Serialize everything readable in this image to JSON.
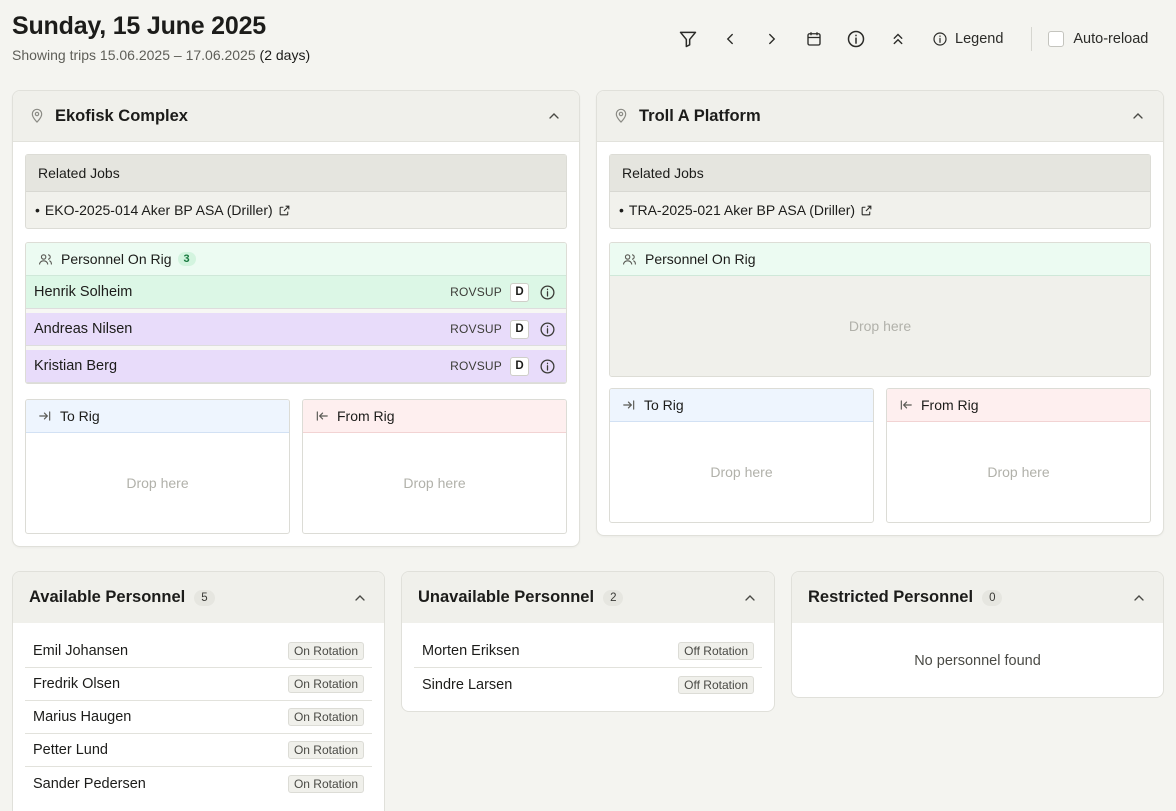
{
  "header": {
    "title": "Sunday, 15 June 2025",
    "subtitle_prefix": "Showing trips 15.06.2025 – 17.06.2025",
    "subtitle_days": "(2 days)"
  },
  "toolbar": {
    "legend_label": "Legend",
    "auto_reload_label": "Auto-reload",
    "auto_reload_checked": false
  },
  "rigs": [
    {
      "name": "Ekofisk Complex",
      "related_jobs_label": "Related Jobs",
      "jobs": [
        "EKO-2025-014 Aker BP ASA (Driller)"
      ],
      "personnel_label": "Personnel On Rig",
      "personnel_count": "3",
      "personnel": [
        {
          "name": "Henrik Solheim",
          "role": "ROVSUP",
          "badge": "D",
          "color": "#dcf7e6"
        },
        {
          "name": "Andreas Nilsen",
          "role": "ROVSUP",
          "badge": "D",
          "color": "#e8dcfa"
        },
        {
          "name": "Kristian Berg",
          "role": "ROVSUP",
          "badge": "D",
          "color": "#e8dcfa"
        }
      ],
      "to_rig_label": "To Rig",
      "from_rig_label": "From Rig",
      "to_rig_drop": "Drop here",
      "from_rig_drop": "Drop here"
    },
    {
      "name": "Troll A Platform",
      "related_jobs_label": "Related Jobs",
      "jobs": [
        "TRA-2025-021 Aker BP ASA (Driller)"
      ],
      "personnel_label": "Personnel On Rig",
      "personnel_drop": "Drop here",
      "to_rig_label": "To Rig",
      "from_rig_label": "From Rig",
      "to_rig_drop": "Drop here",
      "from_rig_drop": "Drop here"
    }
  ],
  "available": {
    "title": "Available Personnel",
    "count": "5",
    "items": [
      {
        "name": "Emil Johansen",
        "status": "On Rotation"
      },
      {
        "name": "Fredrik Olsen",
        "status": "On Rotation"
      },
      {
        "name": "Marius Haugen",
        "status": "On Rotation"
      },
      {
        "name": "Petter Lund",
        "status": "On Rotation"
      },
      {
        "name": "Sander Pedersen",
        "status": "On Rotation"
      }
    ]
  },
  "unavailable": {
    "title": "Unavailable Personnel",
    "count": "2",
    "items": [
      {
        "name": "Morten Eriksen",
        "status": "Off Rotation"
      },
      {
        "name": "Sindre Larsen",
        "status": "Off Rotation"
      }
    ]
  },
  "restricted": {
    "title": "Restricted Personnel",
    "count": "0",
    "empty_text": "No personnel found"
  }
}
